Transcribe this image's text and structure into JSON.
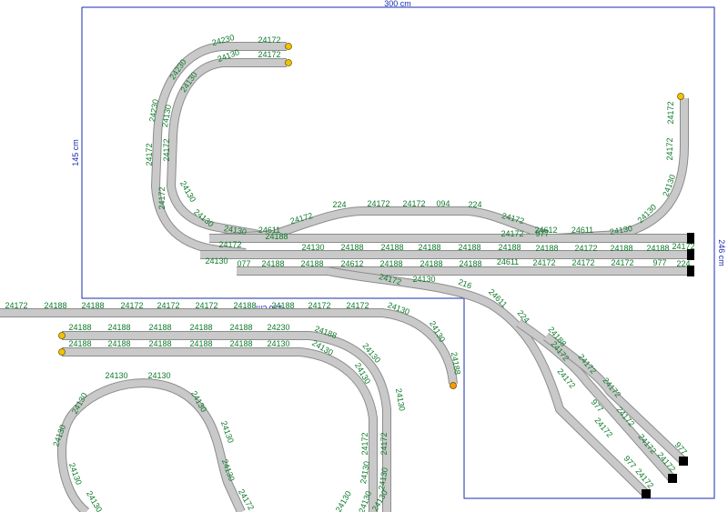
{
  "dimensions": {
    "width": "300 cm",
    "height_left": "145 cm",
    "height_right": "246 cm",
    "inset": "196 cm"
  },
  "colors": {
    "track_edge": "#8c8c8c",
    "track_fill": "#c9c9c9",
    "label": "#0e7a2b",
    "boundary": "#1b2bb0",
    "bumper": "#000000",
    "marker": "#f2c200"
  },
  "labels": [
    "24172",
    "24230",
    "24172",
    "24130",
    "24230",
    "24130",
    "24230",
    "24130",
    "24172",
    "24172",
    "24172",
    "24130",
    "24130",
    "24130",
    "24611",
    "24172",
    "224",
    "24172",
    "24172",
    "094",
    "224",
    "24172",
    "24612",
    "24611",
    "24130",
    "24130",
    "24130",
    "24172",
    "24188",
    "24172",
    "24130",
    "24188",
    "24188",
    "24188",
    "24188",
    "24188",
    "24188",
    "24172",
    "24188",
    "24188",
    "24172",
    "24172",
    "24172",
    "977",
    "24130",
    "077",
    "24188",
    "24188",
    "24612",
    "24188",
    "24188",
    "24188",
    "24611",
    "24172",
    "24172",
    "24172",
    "977",
    "224",
    "24172",
    "24130",
    "216",
    "24611",
    "224",
    "24188",
    "24172",
    "24172",
    "24172",
    "24172",
    "24172",
    "977",
    "24172",
    "24172",
    "977",
    "24172",
    "24172",
    "977",
    "24172",
    "24188",
    "24188",
    "24172",
    "24172",
    "24172",
    "24188",
    "24188",
    "24172",
    "24172",
    "24130",
    "24130",
    "24188",
    "24188",
    "24188",
    "24188",
    "24188",
    "24188",
    "24230",
    "24188",
    "24188",
    "24188",
    "24188",
    "24188",
    "24188",
    "24130",
    "24130",
    "24130",
    "24130",
    "24130",
    "24130",
    "24130",
    "24130",
    "24130",
    "24130",
    "24130",
    "24130",
    "24130",
    "24130",
    "24172",
    "24172",
    "24172",
    "24130",
    "24130",
    "24130",
    "24130",
    "24130",
    "24130"
  ]
}
